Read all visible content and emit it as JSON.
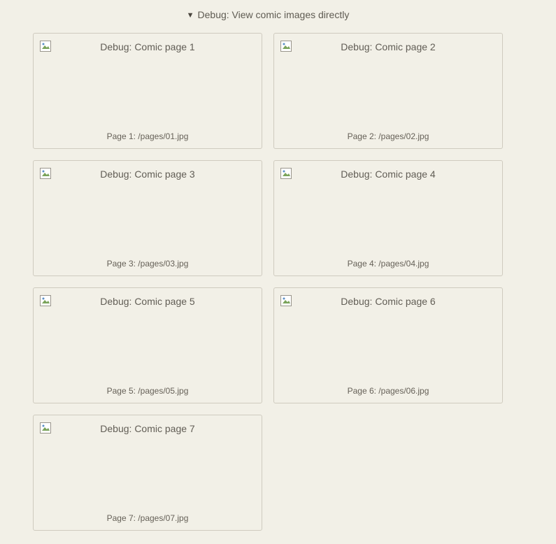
{
  "debug": {
    "summary": "Debug: View comic images directly",
    "disclosure_icon": "triangle-down-icon"
  },
  "pages": [
    {
      "alt": "Debug: Comic page 1",
      "caption": "Page 1: /pages/01.jpg"
    },
    {
      "alt": "Debug: Comic page 2",
      "caption": "Page 2: /pages/02.jpg"
    },
    {
      "alt": "Debug: Comic page 3",
      "caption": "Page 3: /pages/03.jpg"
    },
    {
      "alt": "Debug: Comic page 4",
      "caption": "Page 4: /pages/04.jpg"
    },
    {
      "alt": "Debug: Comic page 5",
      "caption": "Page 5: /pages/05.jpg"
    },
    {
      "alt": "Debug: Comic page 6",
      "caption": "Page 6: /pages/06.jpg"
    },
    {
      "alt": "Debug: Comic page 7",
      "caption": "Page 7: /pages/07.jpg"
    }
  ],
  "colors": {
    "background": "#f2f0e7",
    "card_border": "#cfcbbf",
    "text": "#615d55"
  }
}
